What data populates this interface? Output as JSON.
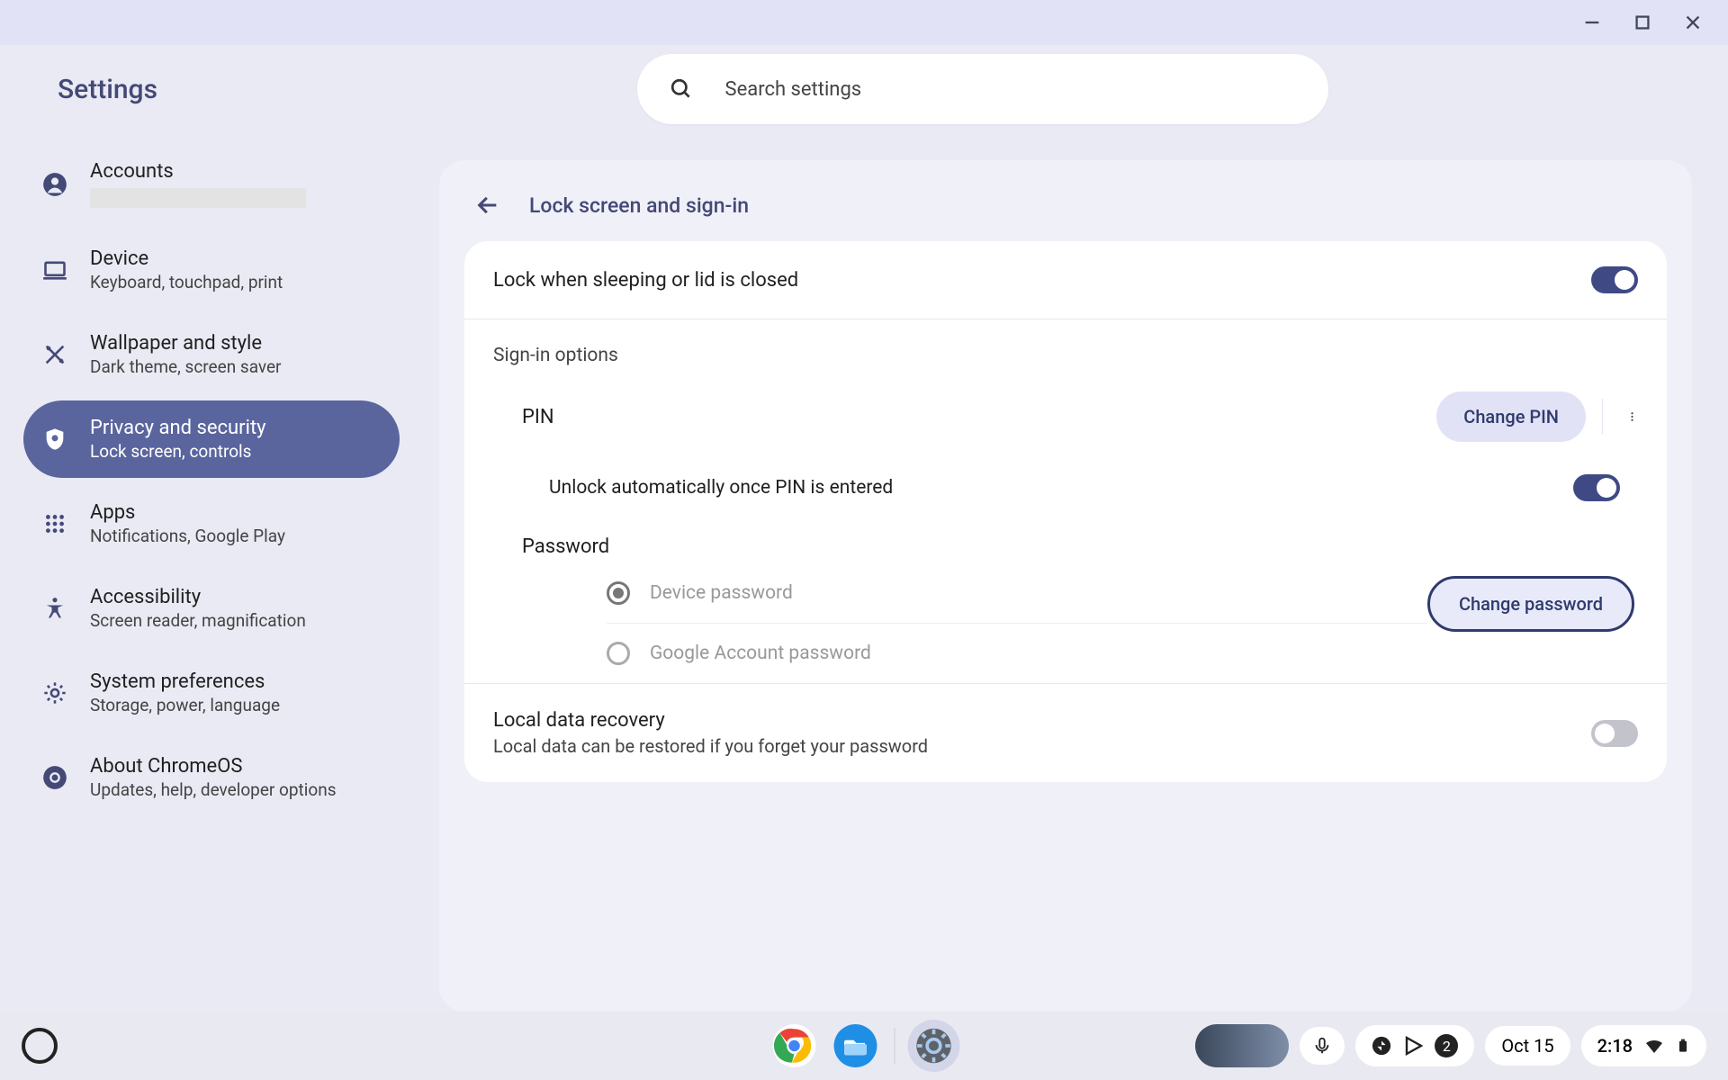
{
  "app_title": "Settings",
  "search": {
    "placeholder": "Search settings"
  },
  "sidebar": {
    "items": [
      {
        "title": "Accounts",
        "sub": ""
      },
      {
        "title": "Device",
        "sub": "Keyboard, touchpad, print"
      },
      {
        "title": "Wallpaper and style",
        "sub": "Dark theme, screen saver"
      },
      {
        "title": "Privacy and security",
        "sub": "Lock screen, controls"
      },
      {
        "title": "Apps",
        "sub": "Notifications, Google Play"
      },
      {
        "title": "Accessibility",
        "sub": "Screen reader, magnification"
      },
      {
        "title": "System preferences",
        "sub": "Storage, power, language"
      },
      {
        "title": "About ChromeOS",
        "sub": "Updates, help, developer options"
      }
    ]
  },
  "page": {
    "title": "Lock screen and sign-in",
    "lock_sleep": {
      "label": "Lock when sleeping or lid is closed",
      "on": true
    },
    "signin_section": "Sign-in options",
    "pin": {
      "label": "PIN",
      "change": "Change PIN",
      "auto_unlock": {
        "label": "Unlock automatically once PIN is entered",
        "on": true
      }
    },
    "password": {
      "label": "Password",
      "change": "Change password",
      "options": [
        {
          "label": "Device password",
          "selected": true
        },
        {
          "label": "Google Account password",
          "selected": false
        }
      ]
    },
    "recovery": {
      "title": "Local data recovery",
      "sub": "Local data can be restored if you forget your password",
      "on": false
    }
  },
  "shelf": {
    "date": "Oct 15",
    "time": "2:18",
    "badge": "2"
  }
}
